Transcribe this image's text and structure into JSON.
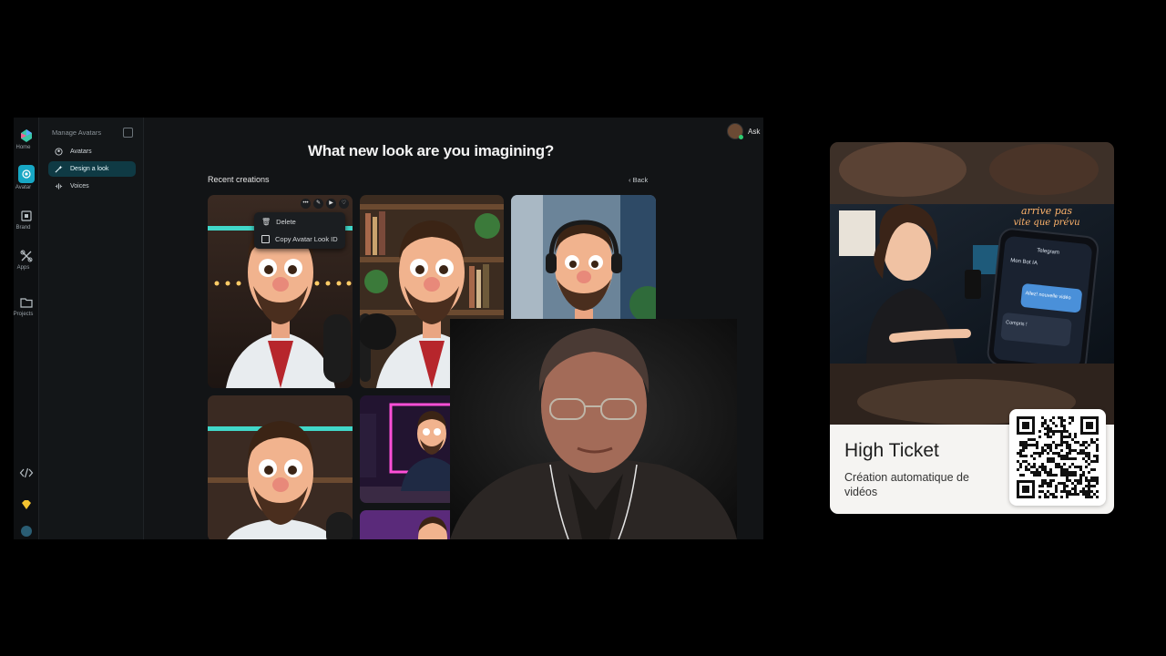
{
  "rail": {
    "items": [
      {
        "label": "Home",
        "icon": "logo-icon"
      },
      {
        "label": "Avatar",
        "icon": "avatar-icon",
        "active": true
      },
      {
        "label": "Brand",
        "icon": "brand-icon"
      },
      {
        "label": "Apps",
        "icon": "apps-icon"
      },
      {
        "label": "Projects",
        "icon": "folder-icon"
      },
      {
        "label": "",
        "icon": "code-icon"
      },
      {
        "label": "",
        "icon": "diamond-icon"
      }
    ]
  },
  "sidebar": {
    "title": "Manage Avatars",
    "items": [
      {
        "label": "Avatars",
        "icon": "user-circle-icon"
      },
      {
        "label": "Design a look",
        "icon": "wand-icon",
        "active": true
      },
      {
        "label": "Voices",
        "icon": "waveform-icon"
      }
    ]
  },
  "header": {
    "user_label": "Ask"
  },
  "main": {
    "heading": "What new look are you imagining?",
    "section_title": "Recent creations",
    "back_label": "Back",
    "context_menu": [
      {
        "label": "Delete",
        "icon": "trash-icon"
      },
      {
        "label": "Copy Avatar Look ID",
        "icon": "copy-icon"
      }
    ]
  },
  "promo": {
    "banner_text_line1": "arrive pas",
    "banner_text_line2": "vite que prévu",
    "phone_title": "Telegram",
    "phone_chat": "Mon Bot IA",
    "phone_msg1": "Allez! nouvelle vidéo",
    "phone_msg2": "Compris !",
    "title": "High Ticket",
    "subtitle": "Création automatique de vidéos"
  },
  "colors": {
    "accent": "#17a7c4",
    "active_bg": "#0f3a44",
    "app_bg": "#121416"
  }
}
